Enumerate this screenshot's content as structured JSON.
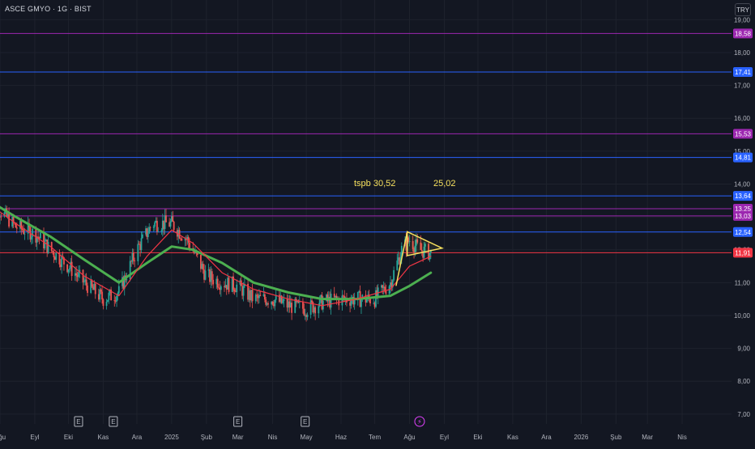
{
  "symbol": {
    "title": "ASCE GMYO · 1G · BIST"
  },
  "toolbar": {
    "currency_label": "TRY"
  },
  "annotations": {
    "note1": "tspb 30,52",
    "note2": "25,02"
  },
  "colors": {
    "background": "#131722",
    "grid": "#1e222d",
    "up": "#26a69a",
    "down": "#ef5350",
    "ma_slow": "#4caf50",
    "ma_fast": "#f23645",
    "blue_level": "#2962ff",
    "purple_level": "#9c27b0",
    "red_level": "#f23645",
    "triangle": "#f6e05e"
  },
  "chart_data": {
    "type": "candlestick",
    "title": "ASCE GMYO · 1G · BIST",
    "price_axis": {
      "range": [
        6.7,
        19.6
      ],
      "ticks": [
        "19,00",
        "18,00",
        "17,00",
        "16,00",
        "15,00",
        "14,00",
        "13,00",
        "12,00",
        "11,00",
        "10,00",
        "9,00",
        "8,00",
        "7,00"
      ]
    },
    "time_axis": {
      "start": "2024-08-01",
      "end": "2026-05-15",
      "ticks": [
        {
          "label": "Ağu",
          "date": "2024-08-01"
        },
        {
          "label": "Eyl",
          "date": "2024-09-01"
        },
        {
          "label": "Eki",
          "date": "2024-10-01"
        },
        {
          "label": "Kas",
          "date": "2024-11-01"
        },
        {
          "label": "Ara",
          "date": "2024-12-01"
        },
        {
          "label": "2025",
          "date": "2025-01-01"
        },
        {
          "label": "Şub",
          "date": "2025-02-01"
        },
        {
          "label": "Mar",
          "date": "2025-03-01"
        },
        {
          "label": "Nis",
          "date": "2025-04-01"
        },
        {
          "label": "May",
          "date": "2025-05-01"
        },
        {
          "label": "Haz",
          "date": "2025-06-01"
        },
        {
          "label": "Tem",
          "date": "2025-07-01"
        },
        {
          "label": "Ağu",
          "date": "2025-08-01"
        },
        {
          "label": "Eyl",
          "date": "2025-09-01"
        },
        {
          "label": "Eki",
          "date": "2025-10-01"
        },
        {
          "label": "Kas",
          "date": "2025-11-01"
        },
        {
          "label": "Ara",
          "date": "2025-12-01"
        },
        {
          "label": "2026",
          "date": "2026-01-01"
        },
        {
          "label": "Şub",
          "date": "2026-02-01"
        },
        {
          "label": "Mar",
          "date": "2026-03-01"
        },
        {
          "label": "Nis",
          "date": "2026-04-01"
        }
      ]
    },
    "price_path": [
      [
        "2024-07-22",
        13.3
      ],
      [
        "2024-08-01",
        13.2
      ],
      [
        "2024-08-15",
        12.7
      ],
      [
        "2024-09-01",
        12.5
      ],
      [
        "2024-09-15",
        12.0
      ],
      [
        "2024-10-01",
        11.5
      ],
      [
        "2024-10-15",
        11.0
      ],
      [
        "2024-11-01",
        10.5
      ],
      [
        "2024-11-15",
        10.7
      ],
      [
        "2024-12-01",
        12.0
      ],
      [
        "2024-12-15",
        12.8
      ],
      [
        "2025-01-01",
        12.8
      ],
      [
        "2025-01-15",
        12.3
      ],
      [
        "2025-02-01",
        11.2
      ],
      [
        "2025-02-15",
        11.0
      ],
      [
        "2025-03-01",
        10.9
      ],
      [
        "2025-03-15",
        10.5
      ],
      [
        "2025-04-01",
        10.5
      ],
      [
        "2025-04-15",
        10.3
      ],
      [
        "2025-05-01",
        10.2
      ],
      [
        "2025-05-15",
        10.4
      ],
      [
        "2025-06-01",
        10.5
      ],
      [
        "2025-06-15",
        10.5
      ],
      [
        "2025-07-01",
        10.5
      ],
      [
        "2025-07-15",
        11.0
      ],
      [
        "2025-07-25",
        12.0
      ],
      [
        "2025-08-01",
        12.3
      ],
      [
        "2025-08-10",
        12.0
      ],
      [
        "2025-08-20",
        11.9
      ]
    ],
    "ma_slow": [
      [
        "2024-07-22",
        13.5
      ],
      [
        "2024-08-15",
        13.0
      ],
      [
        "2024-09-15",
        12.4
      ],
      [
        "2024-10-15",
        11.7
      ],
      [
        "2024-11-15",
        11.0
      ],
      [
        "2024-12-10",
        11.6
      ],
      [
        "2025-01-01",
        12.1
      ],
      [
        "2025-01-20",
        12.0
      ],
      [
        "2025-02-15",
        11.6
      ],
      [
        "2025-03-15",
        11.0
      ],
      [
        "2025-04-15",
        10.7
      ],
      [
        "2025-05-15",
        10.5
      ],
      [
        "2025-06-15",
        10.5
      ],
      [
        "2025-07-15",
        10.6
      ],
      [
        "2025-08-01",
        10.9
      ],
      [
        "2025-08-20",
        11.3
      ]
    ],
    "ma_fast": [
      [
        "2024-07-22",
        13.4
      ],
      [
        "2024-08-15",
        12.8
      ],
      [
        "2024-09-15",
        12.1
      ],
      [
        "2024-10-15",
        11.2
      ],
      [
        "2024-11-15",
        10.6
      ],
      [
        "2024-12-10",
        11.8
      ],
      [
        "2025-01-01",
        12.6
      ],
      [
        "2025-01-20",
        12.2
      ],
      [
        "2025-02-15",
        11.3
      ],
      [
        "2025-03-15",
        10.8
      ],
      [
        "2025-04-15",
        10.5
      ],
      [
        "2025-05-15",
        10.3
      ],
      [
        "2025-06-15",
        10.5
      ],
      [
        "2025-07-15",
        10.8
      ],
      [
        "2025-08-01",
        11.5
      ],
      [
        "2025-08-20",
        11.8
      ]
    ],
    "horizontal_levels": [
      {
        "price": 18.58,
        "label": "18,58",
        "color": "#9c27b0"
      },
      {
        "price": 17.41,
        "label": "17,41",
        "color": "#2962ff"
      },
      {
        "price": 15.53,
        "label": "15,53",
        "color": "#9c27b0"
      },
      {
        "price": 14.81,
        "label": "14,81",
        "color": "#2962ff"
      },
      {
        "price": 13.64,
        "label": "13,64",
        "color": "#2962ff"
      },
      {
        "price": 13.25,
        "label": "13,25",
        "color": "#9c27b0"
      },
      {
        "price": 13.03,
        "label": "13,03",
        "color": "#9c27b0"
      },
      {
        "price": 12.54,
        "label": "12,54",
        "color": "#2962ff"
      },
      {
        "price": 11.91,
        "label": "11,91",
        "color": "#f23645"
      }
    ],
    "pennant": {
      "pole": [
        [
          "2025-07-20",
          10.9
        ],
        [
          "2025-07-30",
          12.55
        ]
      ],
      "triangle": [
        [
          "2025-07-30",
          12.55
        ],
        [
          "2025-08-30",
          12.05
        ],
        [
          "2025-07-30",
          11.82
        ]
      ]
    },
    "event_markers": [
      {
        "date": "2024-10-10",
        "label": "E"
      },
      {
        "date": "2024-11-10",
        "label": "E"
      },
      {
        "date": "2025-03-01",
        "label": "E"
      },
      {
        "date": "2025-04-30",
        "label": "E"
      },
      {
        "date": "2025-08-10",
        "label": "⚡"
      }
    ]
  }
}
